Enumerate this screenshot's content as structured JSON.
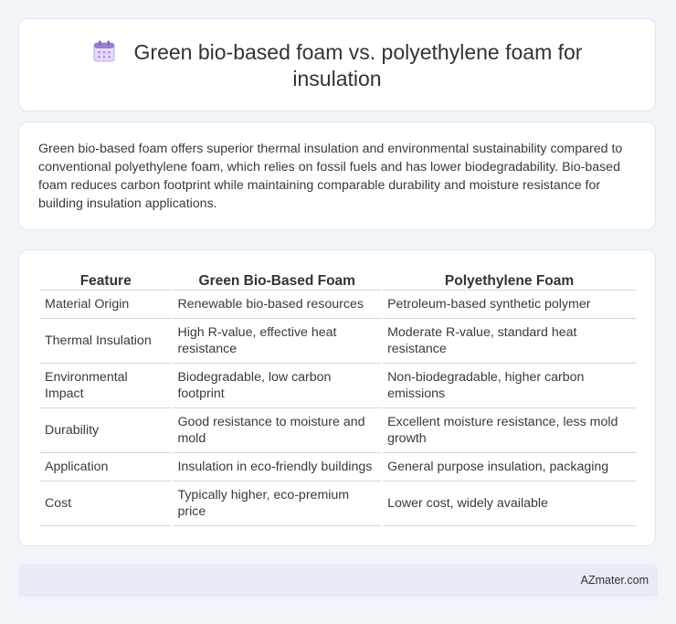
{
  "header": {
    "title": "Green bio-based foam vs. polyethylene foam for insulation",
    "icon": "calendar-icon"
  },
  "summary": "Green bio-based foam offers superior thermal insulation and environmental sustainability compared to conventional polyethylene foam, which relies on fossil fuels and has lower biodegradability. Bio-based foam reduces carbon footprint while maintaining comparable durability and moisture resistance for building insulation applications.",
  "table": {
    "columns": [
      "Feature",
      "Green Bio-Based Foam",
      "Polyethylene Foam"
    ],
    "rows": [
      [
        "Material Origin",
        "Renewable bio-based resources",
        "Petroleum-based synthetic polymer"
      ],
      [
        "Thermal Insulation",
        "High R-value, effective heat resistance",
        "Moderate R-value, standard heat resistance"
      ],
      [
        "Environmental Impact",
        "Biodegradable, low carbon footprint",
        "Non-biodegradable, higher carbon emissions"
      ],
      [
        "Durability",
        "Good resistance to moisture and mold",
        "Excellent moisture resistance, less mold growth"
      ],
      [
        "Application",
        "Insulation in eco-friendly buildings",
        "General purpose insulation, packaging"
      ],
      [
        "Cost",
        "Typically higher, eco-premium price",
        "Lower cost, widely available"
      ]
    ]
  },
  "footer": {
    "brand": "AZmater.com"
  }
}
